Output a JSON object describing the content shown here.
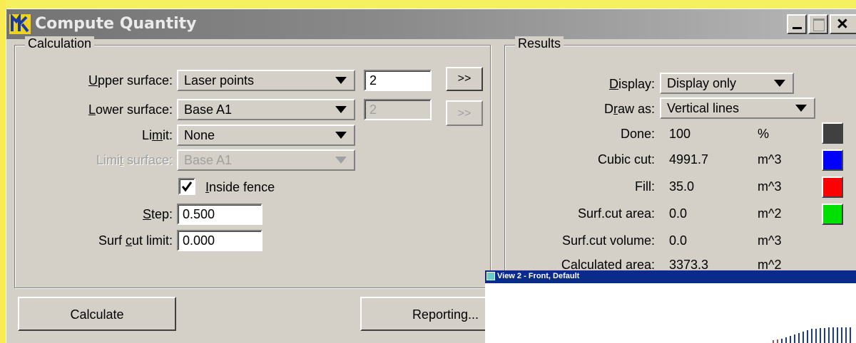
{
  "window": {
    "title": "Compute Quantity"
  },
  "calculation": {
    "group_title": "Calculation",
    "upper_surface": {
      "label_pre": "",
      "label_key": "U",
      "label_post": "pper surface:",
      "value": "Laser points",
      "number": "2",
      "button": ">>"
    },
    "lower_surface": {
      "label_pre": "",
      "label_key": "L",
      "label_post": "ower surface:",
      "value": "Base A1",
      "number": "2",
      "button": ">>"
    },
    "limit": {
      "label_pre": "Li",
      "label_key": "m",
      "label_post": "it:",
      "value": "None"
    },
    "limit_surface": {
      "label_pre": "Limi",
      "label_key": "t",
      "label_post": " surface:",
      "value": "Base A1"
    },
    "inside_fence": {
      "label_key": "I",
      "label_post": "nside fence",
      "checked": true
    },
    "step": {
      "label_key": "S",
      "label_post": "tep:",
      "value": "0.500"
    },
    "surf_cut_limit": {
      "label_pre": "Surf ",
      "label_key": "c",
      "label_post": "ut limit:",
      "value": "0.000"
    },
    "calculate_button": "Calculate",
    "reporting_button": "Reporting..."
  },
  "results": {
    "group_title": "Results",
    "display": {
      "label_key": "D",
      "label_post": "isplay:",
      "value": "Display only"
    },
    "draw_as": {
      "label_pre": "D",
      "label_key": "r",
      "label_post": "aw as:",
      "value": "Vertical lines"
    },
    "rows": [
      {
        "label": "Done:",
        "value": "100",
        "unit": "%",
        "color": "#404040"
      },
      {
        "label": "Cubic cut:",
        "value": "4991.7",
        "unit": "m^3",
        "color": "#0000ff"
      },
      {
        "label": "Fill:",
        "value": "35.0",
        "unit": "m^3",
        "color": "#ff0000"
      },
      {
        "label": "Surf.cut area:",
        "value": "0.0",
        "unit": "m^2",
        "color": "#00e000"
      },
      {
        "label": "Surf.cut volume:",
        "value": "0.0",
        "unit": "m^3"
      },
      {
        "label": "Calculated area:",
        "value": "3373.3",
        "unit": "m^2"
      }
    ]
  },
  "view2": {
    "title": "View 2 - Front, Default"
  }
}
